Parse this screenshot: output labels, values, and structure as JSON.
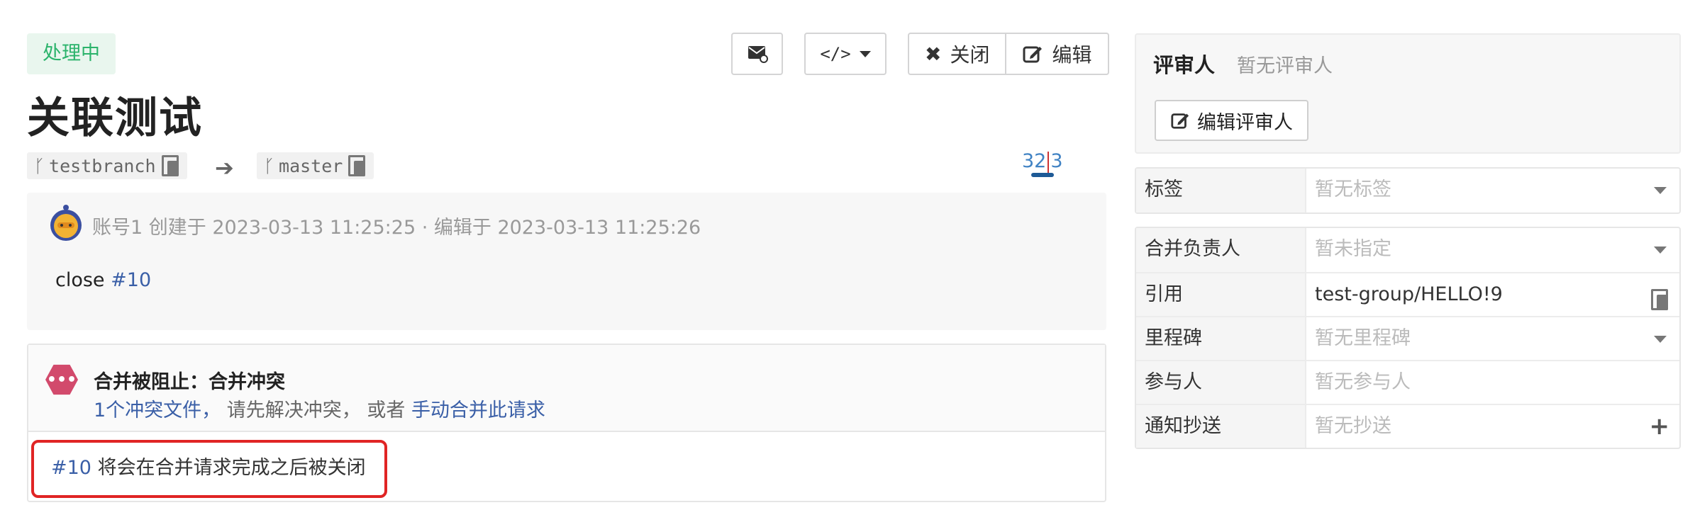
{
  "status": "处理中",
  "toolbar": {
    "close_label": "关闭",
    "edit_label": "编辑",
    "mail_icon": "mail-icon",
    "code_icon": "code-icon"
  },
  "title": "关联测试",
  "branches": {
    "source": "testbranch",
    "target": "master"
  },
  "diffstat": {
    "additions": "32",
    "deletions": "3"
  },
  "description": {
    "author": "账号1",
    "meta": "创建于 2023-03-13 11:25:25 · 编辑于 2023-03-13 11:25:26",
    "text_prefix": "close ",
    "issue_link": "#10"
  },
  "merge": {
    "title": "合并被阻止：合并冲突",
    "conflict_link": "1个冲突文件，",
    "sub_middle": " 请先解决冲突， 或者 ",
    "manual_link": "手动合并此请求",
    "footer_link": "#10",
    "footer_text": " 将会在合并请求完成之后被关闭"
  },
  "reviewers": {
    "label": "评审人",
    "empty": "暂无评审人",
    "edit_button": "编辑评审人"
  },
  "props_top": [
    {
      "key": "标签",
      "value": "暂无标签"
    }
  ],
  "props": [
    {
      "key": "合并负责人",
      "value": "暂未指定"
    },
    {
      "key": "引用",
      "value": "test-group/HELLO!9"
    },
    {
      "key": "里程碑",
      "value": "暂无里程碑"
    },
    {
      "key": "参与人",
      "value": "暂无参与人"
    },
    {
      "key": "通知抄送",
      "value": "暂无抄送"
    }
  ],
  "colors": {
    "status_green": "#2bb36b",
    "link_blue": "#3a5fa7",
    "conflict_red": "#d24a6c",
    "highlight_red": "#e02424"
  }
}
